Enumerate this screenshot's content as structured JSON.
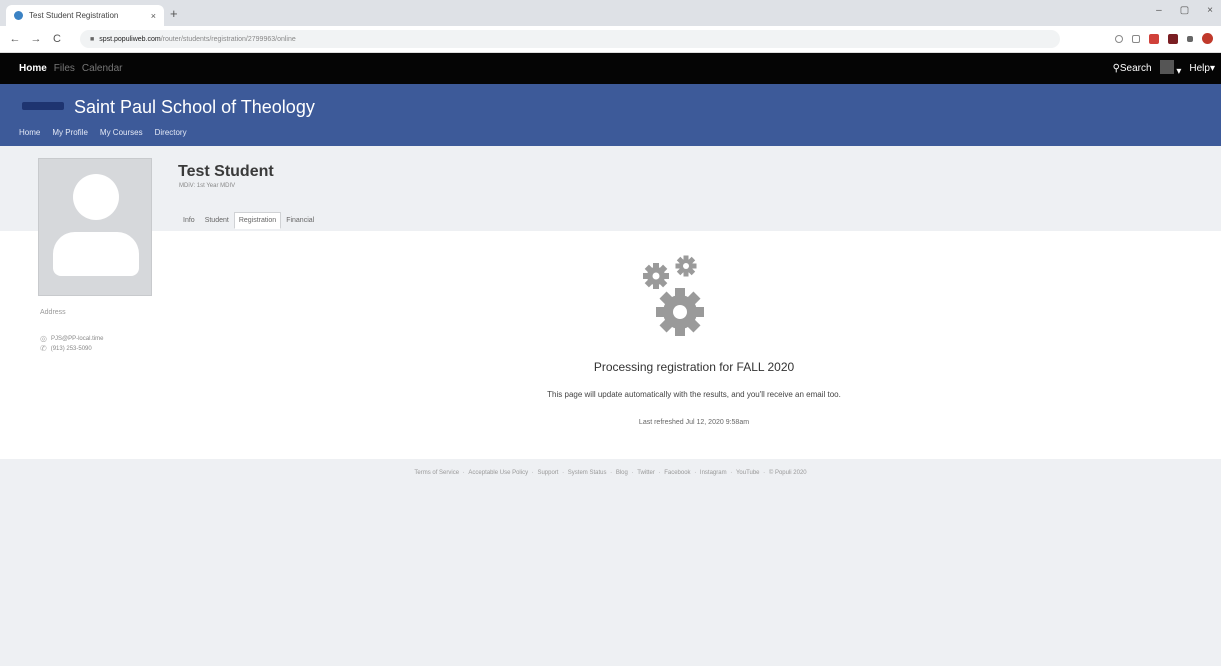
{
  "browser": {
    "tab_title": "Test Student Registration",
    "tab_close": "×",
    "new_tab": "+",
    "url_host": "spst.populiweb.com",
    "url_path": "/router/students/registration/2799963/online",
    "window_controls": [
      "–",
      "▢",
      "×"
    ]
  },
  "topbar": {
    "nav": [
      "Home",
      "Files",
      "Calendar"
    ],
    "search_label": "Search",
    "help_label": "Help"
  },
  "banner": {
    "school_name": "Saint Paul School of Theology",
    "links": [
      "Home",
      "My Profile",
      "My Courses",
      "Directory"
    ]
  },
  "profile": {
    "name": "Test Student",
    "program": "MDiV: 1st Year MDIV",
    "tabs": [
      "Info",
      "Student",
      "Registration",
      "Financial"
    ],
    "active_tab": "Registration",
    "sidebar_heading": "Address",
    "contact": [
      {
        "icon": "email-icon",
        "text": "PJS@PP-local.time"
      },
      {
        "icon": "phone-icon",
        "text": "(913) 253-5090"
      }
    ]
  },
  "registration": {
    "title": "Processing registration for FALL 2020",
    "note": "This page will update automatically with the results, and you'll receive an email too.",
    "last_refreshed": "Last refreshed Jul 12, 2020 9:58am"
  },
  "footer": {
    "links": [
      "Terms of Service",
      "Acceptable Use Policy",
      "Support",
      "System Status",
      "Blog",
      "Twitter",
      "Facebook",
      "Instagram",
      "YouTube",
      "© Populi 2020"
    ]
  },
  "colors": {
    "banner": "#3d5a99",
    "topbar": "#050505",
    "page_bg": "#eef0f3",
    "gear": "#9a9a9a"
  }
}
